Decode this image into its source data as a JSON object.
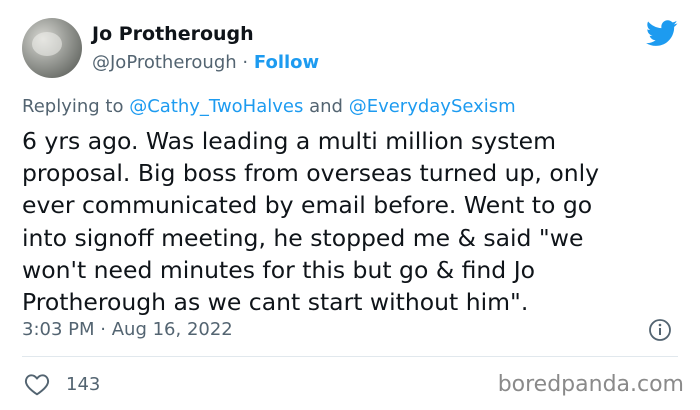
{
  "author": {
    "name": "Jo Protherough",
    "handle": "@JoProtherough",
    "separator": "·",
    "follow_label": "Follow"
  },
  "reply": {
    "prefix": "Replying to",
    "mention1": "@Cathy_TwoHalves",
    "conjunction": "and",
    "mention2": "@EverydaySexism"
  },
  "tweet": {
    "lines": [
      "6 yrs ago. Was leading a multi million system",
      "proposal. Big boss from overseas turned up, only",
      "ever communicated by email before.  Went to go",
      "into signoff meeting, he stopped me & said \"we",
      "won't need minutes for this but go & find Jo",
      "Protherough as we cant start without him\"."
    ]
  },
  "meta": {
    "time": "3:03 PM",
    "separator": "·",
    "date": "Aug 16, 2022"
  },
  "actions": {
    "like_count": "143"
  },
  "watermark": "boredpanda.com",
  "icons": {
    "brand": "twitter-bird-icon",
    "info": "info-icon",
    "like": "heart-icon"
  },
  "colors": {
    "accent": "#1d9bf0",
    "muted": "#536471",
    "text": "#0f1419"
  }
}
